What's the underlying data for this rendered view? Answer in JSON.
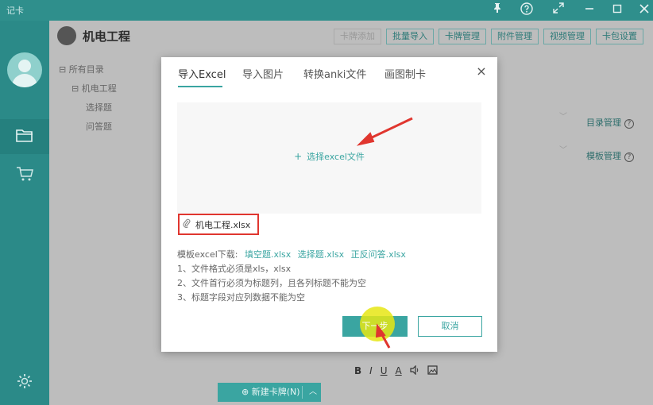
{
  "app": {
    "logo": "记卡"
  },
  "window_controls": [
    "pin-icon",
    "help-icon",
    "fullscreen-icon",
    "minimize-icon",
    "maximize-icon",
    "close-icon"
  ],
  "sidebar": {
    "icons": [
      "avatar",
      "folder-icon",
      "cart-icon",
      "gear-icon"
    ]
  },
  "workspace": {
    "deck_title": "机电工程",
    "toolbar": [
      "卡牌添加",
      "批量导入",
      "卡牌管理",
      "附件管理",
      "视频管理",
      "卡包设置"
    ],
    "tree": {
      "root": "所有目录",
      "deck": "机电工程",
      "children": [
        "选择题",
        "问答题"
      ]
    },
    "right_links": [
      {
        "label": "目录管理"
      },
      {
        "label": "模板管理"
      }
    ],
    "format_bar": [
      "B",
      "I",
      "U",
      "A"
    ],
    "new_card_button": "新建卡牌(N)"
  },
  "modal": {
    "tabs": [
      "导入Excel",
      "导入图片",
      "转换anki文件",
      "画图制卡"
    ],
    "active_tab": 0,
    "close_glyph": "×",
    "drop_zone": {
      "plus": "+",
      "label": "选择excel文件"
    },
    "selected_file": "机电工程.xlsx",
    "template": {
      "label": "模板excel下载:",
      "links": [
        "填空题.xlsx",
        "选择题.xlsx",
        "正反问答.xlsx"
      ]
    },
    "notes": [
      "1、文件格式必须是xls，xlsx",
      "2、文件首行必须为标题列，且各列标题不能为空",
      "3、标题字段对应列数据不能为空"
    ],
    "next_button": "下一步",
    "cancel_button": "取消"
  },
  "colors": {
    "accent": "#3aa5a1",
    "annotation": "#e0362f",
    "sidebar": "#2b8a88"
  }
}
